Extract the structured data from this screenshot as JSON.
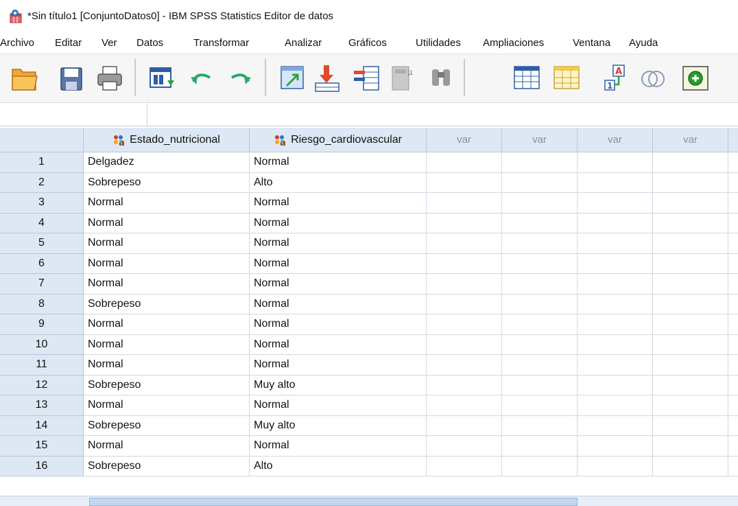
{
  "window": {
    "title": "*Sin título1 [ConjuntoDatos0] - IBM SPSS Statistics Editor de datos"
  },
  "menu": [
    "Archivo",
    "Editar",
    "Ver",
    "Datos",
    "Transformar",
    "Analizar",
    "Gráficos",
    "Utilidades",
    "Ampliaciones",
    "Ventana",
    "Ayuda"
  ],
  "toolbar": {
    "icons": [
      "open-folder-icon",
      "save-icon",
      "print-icon",
      "dialog-recall-icon",
      "undo-icon",
      "redo-icon",
      "goto-case-icon",
      "goto-variable-icon",
      "variables-icon",
      "run-descriptives-icon",
      "find-icon",
      "insert-cases-icon",
      "insert-variable-icon",
      "value-labels-icon",
      "use-sets-icon",
      "extension-icon"
    ]
  },
  "cell_editor": {
    "reference": "",
    "value": ""
  },
  "grid": {
    "columns": [
      {
        "name": "Estado_nutricional",
        "type_icon": "nominal-variable-icon"
      },
      {
        "name": "Riesgo_cardiovascular",
        "type_icon": "nominal-variable-icon"
      },
      {
        "name": "var"
      },
      {
        "name": "var"
      },
      {
        "name": "var"
      },
      {
        "name": "var"
      }
    ],
    "rows": [
      {
        "n": "1",
        "c1": "Delgadez",
        "c2": "Normal"
      },
      {
        "n": "2",
        "c1": "Sobrepeso",
        "c2": "Alto"
      },
      {
        "n": "3",
        "c1": "Normal",
        "c2": "Normal"
      },
      {
        "n": "4",
        "c1": "Normal",
        "c2": "Normal"
      },
      {
        "n": "5",
        "c1": "Normal",
        "c2": "Normal"
      },
      {
        "n": "6",
        "c1": "Normal",
        "c2": "Normal"
      },
      {
        "n": "7",
        "c1": "Normal",
        "c2": "Normal"
      },
      {
        "n": "8",
        "c1": "Sobrepeso",
        "c2": "Normal"
      },
      {
        "n": "9",
        "c1": "Normal",
        "c2": "Normal"
      },
      {
        "n": "10",
        "c1": "Normal",
        "c2": "Normal"
      },
      {
        "n": "11",
        "c1": "Normal",
        "c2": "Normal"
      },
      {
        "n": "12",
        "c1": "Sobrepeso",
        "c2": "Muy alto"
      },
      {
        "n": "13",
        "c1": "Normal",
        "c2": "Normal"
      },
      {
        "n": "14",
        "c1": "Sobrepeso",
        "c2": "Muy alto"
      },
      {
        "n": "15",
        "c1": "Normal",
        "c2": "Normal"
      },
      {
        "n": "16",
        "c1": "Sobrepeso",
        "c2": "Alto"
      }
    ]
  }
}
